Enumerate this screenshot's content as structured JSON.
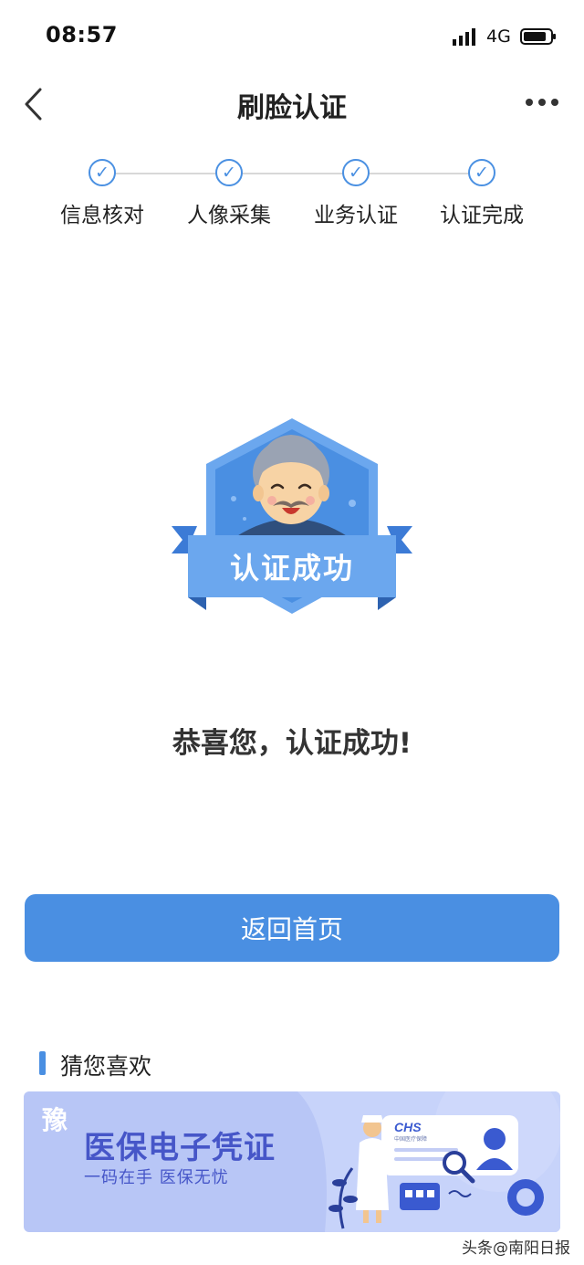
{
  "status_bar": {
    "time": "08:57",
    "network": "4G"
  },
  "nav": {
    "title": "刷脸认证"
  },
  "steps": [
    {
      "label": "信息核对",
      "done": true
    },
    {
      "label": "人像采集",
      "done": true
    },
    {
      "label": "业务认证",
      "done": true
    },
    {
      "label": "认证完成",
      "done": true
    }
  ],
  "step_check": "✓",
  "badge": {
    "text": "认证成功"
  },
  "result": {
    "message": "恭喜您，认证成功!"
  },
  "home_button": {
    "label": "返回首页"
  },
  "recommend": {
    "title": "猜您喜欢",
    "banner": {
      "title": "医保电子凭证",
      "subtitle": "一码在手 医保无忧",
      "logo_mark": "豫",
      "card_logo": "CHS",
      "card_caption": "中国医疗保障"
    }
  },
  "watermark": "头条@南阳日报",
  "colors": {
    "accent": "#4a8fe2",
    "banner_bg": "#b8c6f6",
    "banner_text": "#4656c8"
  }
}
